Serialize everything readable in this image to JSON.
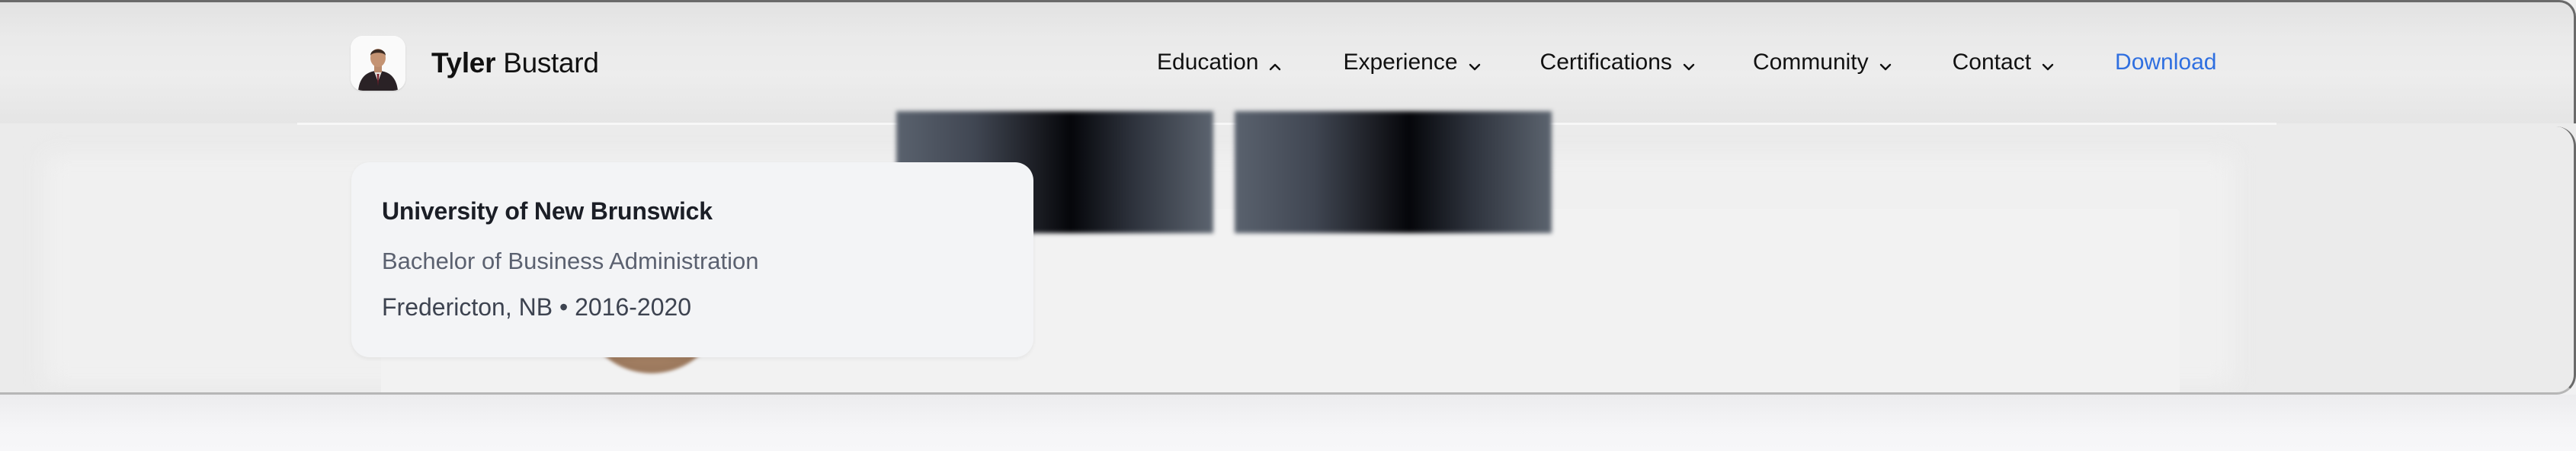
{
  "brand": {
    "first_name": "Tyler",
    "last_name": "Bustard",
    "avatar_icon": "profile-photo"
  },
  "nav": {
    "items": [
      {
        "label": "Education",
        "chevron": "chevron-up-icon",
        "expanded": true
      },
      {
        "label": "Experience",
        "chevron": "chevron-down-icon",
        "expanded": false
      },
      {
        "label": "Certifications",
        "chevron": "chevron-down-icon",
        "expanded": false
      },
      {
        "label": "Community",
        "chevron": "chevron-down-icon",
        "expanded": false
      },
      {
        "label": "Contact",
        "chevron": "chevron-down-icon",
        "expanded": false
      }
    ],
    "download_label": "Download"
  },
  "education_dropdown": {
    "institution": "University of New Brunswick",
    "degree": "Bachelor of Business Administration",
    "meta": "Fredericton, NB • 2016-2020"
  },
  "colors": {
    "accent_link": "#2f6fe0",
    "text_primary": "#111111",
    "card_background": "#f3f4f6"
  }
}
